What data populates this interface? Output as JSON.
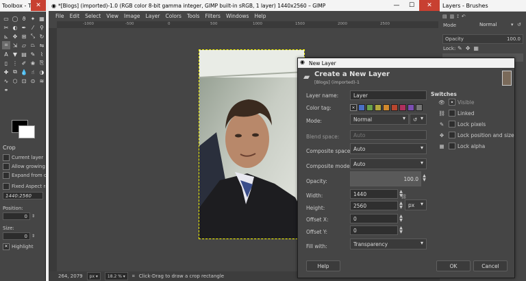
{
  "toolbox": {
    "title": "Toolbox - To...",
    "options_title": "Crop",
    "current_layer": "Current layer",
    "allow_growing": "Allow growing",
    "expand_from": "Expand from center",
    "fixed": "Fixed Aspect ratio",
    "ratio": "1440:2560",
    "position_label": "Position:",
    "position_value": "0",
    "size_label": "Size:",
    "size_value": "0",
    "highlight": "Highlight"
  },
  "gimp": {
    "title": "*[Blogs] (imported)-1.0 (RGB color 8-bit gamma integer, GIMP built-in sRGB, 1 layer) 1440x2560 – GIMP",
    "menu": [
      "File",
      "Edit",
      "Select",
      "View",
      "Image",
      "Layer",
      "Colors",
      "Tools",
      "Filters",
      "Windows",
      "Help"
    ],
    "ruler_marks": [
      "-1000",
      "-500",
      "0",
      "500",
      "1000",
      "1500",
      "2000",
      "2500"
    ],
    "status_coords": "264, 2079",
    "status_unit": "px",
    "status_zoom": "18.2 %",
    "status_hint": "Click-Drag to draw a crop rectangle"
  },
  "layers": {
    "title": "Layers - Brushes",
    "mode_label": "Mode",
    "mode_value": "Normal",
    "opacity_label": "Opacity",
    "opacity_value": "100.0",
    "lock_label": "Lock:"
  },
  "dialog": {
    "title": "New Layer",
    "heading": "Create a New Layer",
    "subheading": "[Blogs] (imported)-1",
    "layer_name_label": "Layer name:",
    "layer_name": "Layer",
    "color_tag_label": "Color tag:",
    "mode_label": "Mode:",
    "mode_value": "Normal",
    "blend_label": "Blend space:",
    "blend_value": "Auto",
    "composite_space_label": "Composite space:",
    "composite_space_value": "Auto",
    "composite_mode_label": "Composite mode:",
    "composite_mode_value": "Auto",
    "opacity_label": "Opacity:",
    "opacity_value": "100.0",
    "width_label": "Width:",
    "width_value": "1440",
    "height_label": "Height:",
    "height_value": "2560",
    "unit_value": "px",
    "offx_label": "Offset X:",
    "offx_value": "0",
    "offy_label": "Offset Y:",
    "offy_value": "0",
    "fill_label": "Fill with:",
    "fill_value": "Transparency",
    "switches_title": "Switches",
    "visible": "Visible",
    "linked": "Linked",
    "lock_pixels": "Lock pixels",
    "lock_position": "Lock position and size",
    "lock_alpha": "Lock alpha",
    "help": "Help",
    "ok": "OK",
    "cancel": "Cancel",
    "tag_colors": [
      "#2a2a2a",
      "#4a6fc4",
      "#6aa24a",
      "#b4a83e",
      "#d0892e",
      "#b8462f",
      "#b0305e",
      "#7b4fb2",
      "#777777"
    ]
  }
}
